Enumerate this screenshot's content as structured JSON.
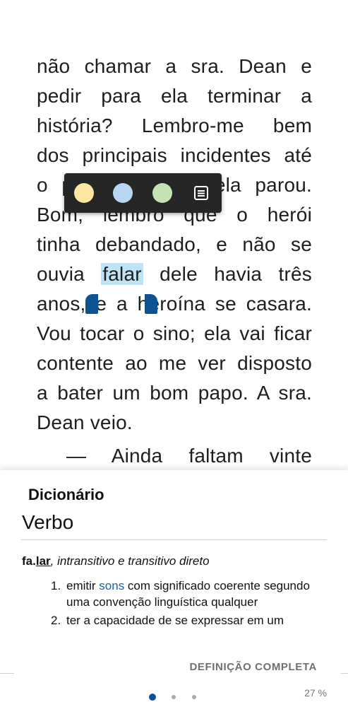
{
  "reader": {
    "lines": [
      "não chamar a sra. Dean e",
      "pedir para ela terminar a",
      "história? Lembro-me bem",
      "dos principais incidentes até",
      "o ponto em que ela parou.",
      "Bom, lembro que o herói",
      "tinha debandado, e não se"
    ],
    "highlight_line": {
      "before": "ouvia ",
      "word": "falar",
      "after": " dele havia três"
    },
    "lines_after": [
      "anos, e a heroína se casara.",
      "Vou tocar o sino; ela vai ficar",
      "contente ao me ver disposto",
      "a bater um bom papo. A sra.",
      "Dean veio."
    ],
    "dialog_line": "— Ainda faltam vinte"
  },
  "highlight_toolbar": {
    "colors": [
      "#fde7a0",
      "#b8d6f2",
      "#c3e3b4"
    ],
    "note_icon": "note-icon"
  },
  "dictionary": {
    "title": "Dicionário",
    "part_of_speech": "Verbo",
    "entry": {
      "lemma_pre": "fa.",
      "lemma_stress": "lar",
      "grammar": ", intransitivo e transitivo direto"
    },
    "definitions": [
      {
        "num": "1.",
        "pre": "emitir ",
        "link": "sons",
        "post": " com significado coerente segundo uma convenção linguística qualquer"
      },
      {
        "num": "2.",
        "pre": "ter a capacidade de se expressar em um",
        "link": "",
        "post": ""
      }
    ],
    "full_definition_label": "DEFINIÇÃO COMPLETA"
  },
  "pager": {
    "count": 3,
    "active": 0
  },
  "progress": "27 %",
  "colors": {
    "accent": "#0d5394",
    "selection": "#bfe3f6",
    "toolbar_bg": "#262626"
  }
}
